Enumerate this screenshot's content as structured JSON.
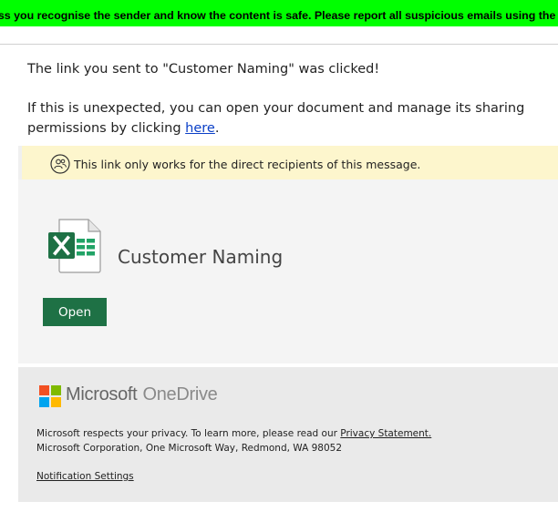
{
  "banner": {
    "text": "ess you recognise the sender and know the content is safe. Please report all suspicious emails using the R"
  },
  "message": {
    "line1": "The link you sent to \"Customer Naming\" was clicked!",
    "line2_prefix": "If this is unexpected, you can open your document and manage its sharing permissions by clicking ",
    "link_text": "here",
    "line2_suffix": "."
  },
  "notice": {
    "icon": "people-icon",
    "text": "This link only works for the direct recipients of this message."
  },
  "document": {
    "icon": "excel-icon",
    "name": "Customer Naming",
    "open_label": "Open",
    "accent": "#1e7145"
  },
  "footer": {
    "brand_microsoft": "Microsoft",
    "brand_onedrive": "OneDrive",
    "privacy_prefix": "Microsoft respects your privacy. To learn more, please read our ",
    "privacy_link": "Privacy Statement.",
    "address": "Microsoft Corporation, One Microsoft Way, Redmond, WA 98052",
    "notification_settings": "Notification Settings"
  },
  "colors": {
    "banner_bg": "#00ff00",
    "notice_bg": "#fdf6cd",
    "card_bg": "#f4f4f4",
    "footer_bg": "#eaeaea",
    "link": "#0a3fc7"
  }
}
